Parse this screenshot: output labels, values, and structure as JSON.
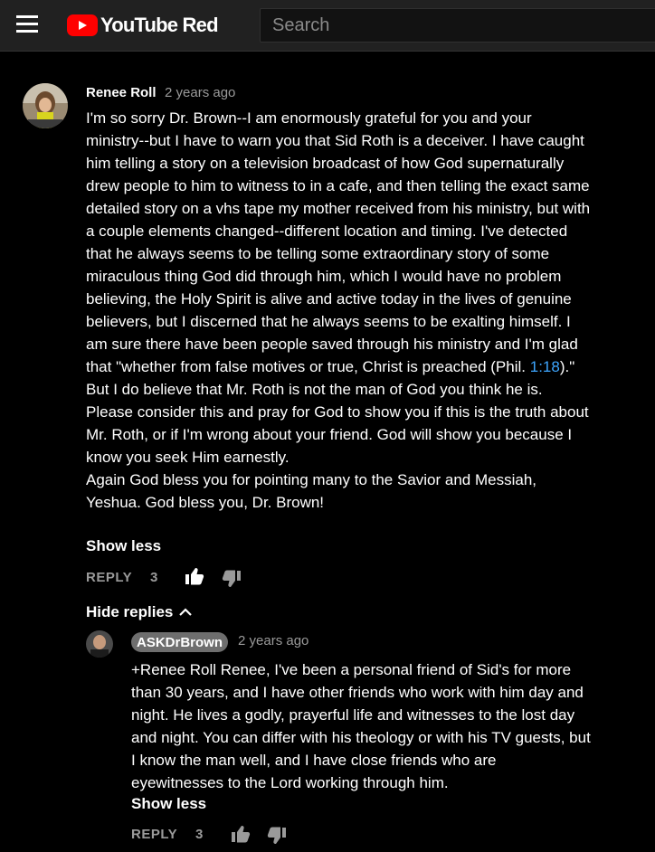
{
  "header": {
    "brand_text": "YouTube Red",
    "search_placeholder": "Search",
    "icons": [
      "menu-icon",
      "youtube-play-icon"
    ],
    "brand_color": "#ff0000"
  },
  "comment": {
    "author": "Renee Roll",
    "time": "2 years ago",
    "body": {
      "p1_before": "I'm so sorry Dr. Brown--I am enormously grateful for you and your ministry--but I have to warn you that Sid Roth is a deceiver. I have caught him telling a story on a television broadcast of how God supernaturally drew people to him to witness to in a cafe, and then telling the exact same detailed story on a vhs tape my mother received from his ministry, but with a couple elements changed--different location and timing. I've detected that he always seems to be telling some extraordinary story of some miraculous thing God did through him, which I would have no problem believing, the Holy Spirit is alive and active today in the lives of genuine believers, but I discerned that he always seems to be exalting himself. I am sure there have been people saved through his ministry and I'm glad that \"whether from false motives or true, Christ is preached (Phil. ",
      "link": "1:18",
      "p1_after": ").\" But I do believe that Mr. Roth is not the man of God you think he is. Please consider this and pray for God to show you if this is the truth about Mr. Roth, or if I'm wrong about your friend. God will show you because I know you seek Him earnestly.",
      "p2": "Again God bless you for pointing many to the Savior and Messiah, Yeshua. God bless you, Dr. Brown!"
    },
    "show_less": "Show less",
    "reply_label": "REPLY",
    "likes": "3",
    "hide_replies": "Hide replies"
  },
  "reply": {
    "author": "ASKDrBrown",
    "time": "2 years ago",
    "body": "+Renee Roll Renee, I've been a personal friend of Sid's for more than 30 years, and I have other friends who work with him day and night. He lives a godly, prayerful life and witnesses to the lost day and night. You can differ with his theology or with his TV guests, but I know the man well, and I have close friends who are eyewitnesses to the Lord working through him.",
    "show_less": "Show less",
    "reply_label": "REPLY",
    "likes": "3"
  }
}
